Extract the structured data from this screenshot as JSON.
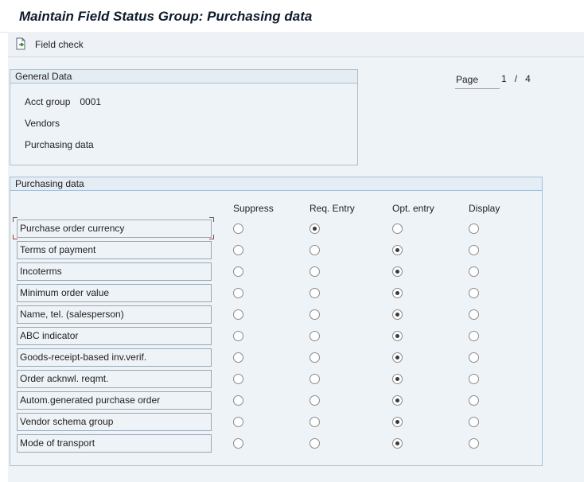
{
  "window": {
    "title": "Maintain Field Status Group: Purchasing data"
  },
  "toolbar": {
    "field_check_label": "Field check",
    "field_check_icon": "document-arrow-icon"
  },
  "general_data": {
    "header": "General Data",
    "acct_group_label": "Acct group",
    "acct_group_value": "0001",
    "line2": "Vendors",
    "line3": "Purchasing data"
  },
  "pager": {
    "label": "Page",
    "current": "1",
    "separator": "/",
    "total": "4"
  },
  "purchasing": {
    "header": "Purchasing data",
    "columns": [
      "Suppress",
      "Req. Entry",
      "Opt. entry",
      "Display"
    ],
    "rows": [
      {
        "label": "Purchase order currency",
        "selected": 1
      },
      {
        "label": "Terms of payment",
        "selected": 2
      },
      {
        "label": "Incoterms",
        "selected": 2
      },
      {
        "label": "Minimum order value",
        "selected": 2
      },
      {
        "label": "Name, tel. (salesperson)",
        "selected": 2
      },
      {
        "label": "ABC indicator",
        "selected": 2
      },
      {
        "label": "Goods-receipt-based inv.verif.",
        "selected": 2
      },
      {
        "label": "Order acknwl. reqmt.",
        "selected": 2
      },
      {
        "label": "Autom.generated purchase order",
        "selected": 2
      },
      {
        "label": "Vendor schema group",
        "selected": 2
      },
      {
        "label": "Mode of transport",
        "selected": 2
      }
    ]
  }
}
